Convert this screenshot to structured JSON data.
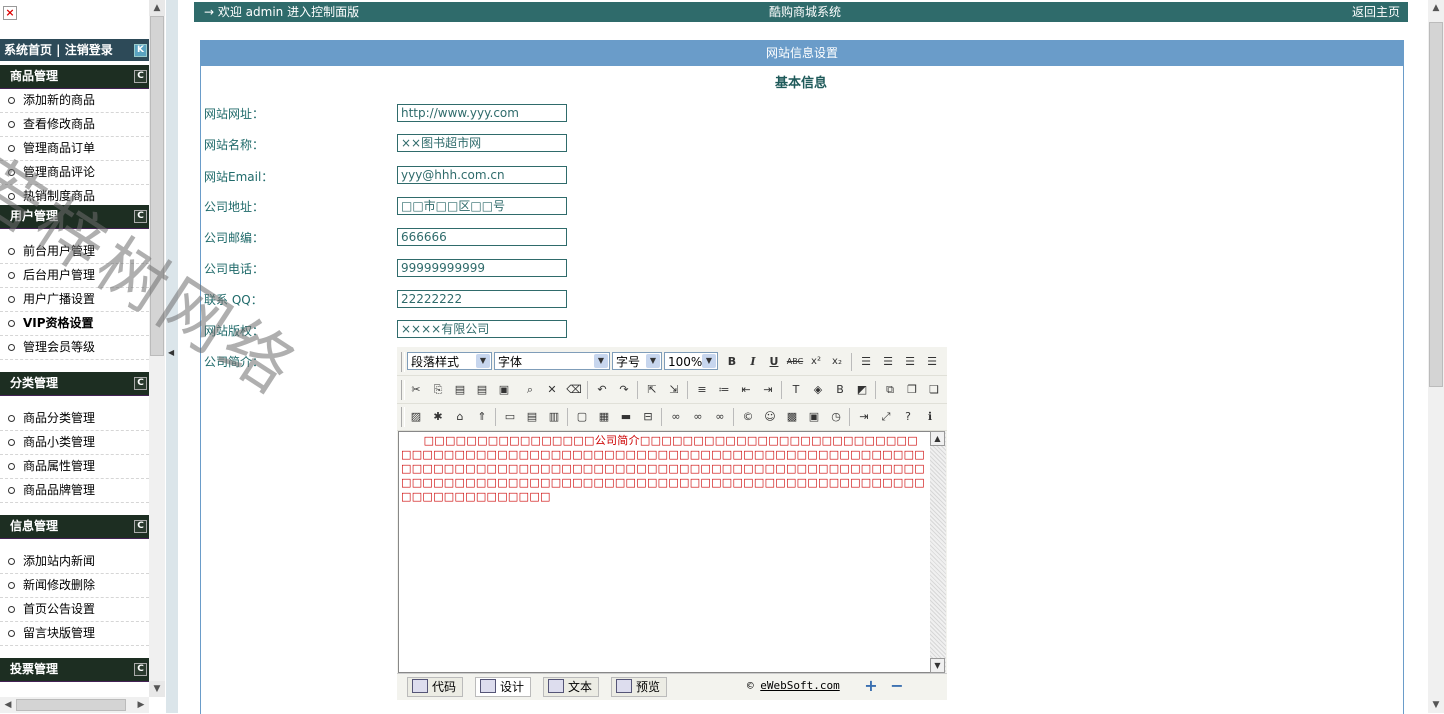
{
  "sidebar": {
    "home_bar": "系统首页 | 注销登录",
    "home_toggle": "K",
    "sections": [
      {
        "title": "商品管理",
        "toggle": "C",
        "items": [
          "添加新的商品",
          "查看修改商品",
          "管理商品订单",
          "管理商品评论",
          "热销制度商品"
        ]
      },
      {
        "title": "用户管理",
        "toggle": "C",
        "items": [
          "前台用户管理",
          "后台用户管理",
          "用户广播设置",
          "VIP资格设置",
          "管理会员等级"
        ]
      },
      {
        "title": "分类管理",
        "toggle": "C",
        "items": [
          "商品分类管理",
          "商品小类管理",
          "商品属性管理",
          "商品品牌管理"
        ]
      },
      {
        "title": "信息管理",
        "toggle": "C",
        "items": [
          "添加站内新闻",
          "新闻修改删除",
          "首页公告设置",
          "留言块版管理"
        ]
      },
      {
        "title": "投票管理",
        "toggle": "C",
        "items": []
      }
    ]
  },
  "topbar": {
    "welcome": "→ 欢迎 admin 进入控制面版",
    "center": "酷购商城系统",
    "right": "返回主页"
  },
  "panel": {
    "header": "网站信息设置",
    "section_title": "基本信息",
    "fields": [
      {
        "label": "网站网址：",
        "value": "http://www.yyy.com"
      },
      {
        "label": "网站名称：",
        "value": "××图书超市网"
      },
      {
        "label": "网站Email：",
        "value": "yyy@hhh.com.cn"
      },
      {
        "label": "公司地址：",
        "value": "□□市□□区□□号"
      },
      {
        "label": "公司邮编：",
        "value": "666666"
      },
      {
        "label": "公司电话：",
        "value": "99999999999"
      },
      {
        "label": "联系 QQ：",
        "value": "22222222"
      },
      {
        "label": "网站版权：",
        "value": "××××有限公司"
      }
    ],
    "intro_label": "公司简介："
  },
  "editor": {
    "paragraph_select": "段落样式",
    "font_select": "字体",
    "size_select": "字号",
    "zoom_select": "100%",
    "content": "　　□□□□□□□□□□□□□□□□公司简介□□□□□□□□□□□□□□□□□□□□□□□□□□□□□□□□□□□□□□□□□□□□□□□□□□□□□□□□□□□□□□□□□□□□□□□□□□□□□□□□□□□□□□□□□□□□□□□□□□□□□□□□□□□□□□□□□□□□□□□□□□□□□□□□□□□□□□□□□□□□□□□□□□□□□□□□□□□□□□□□□□□□□□□□□□□□□□□□□□□□□□□□□□□",
    "modes": [
      "代码",
      "设计",
      "文本",
      "预览"
    ],
    "copyright_prefix": "© ",
    "copyright_link": "eWebSoft.com"
  },
  "watermark": "若梓树网络",
  "colors": {
    "topbar": "#2f6b6b",
    "panel_header": "#6a9cc9",
    "sidebar_head": "#1d2e22",
    "content_red": "#cc0000"
  }
}
